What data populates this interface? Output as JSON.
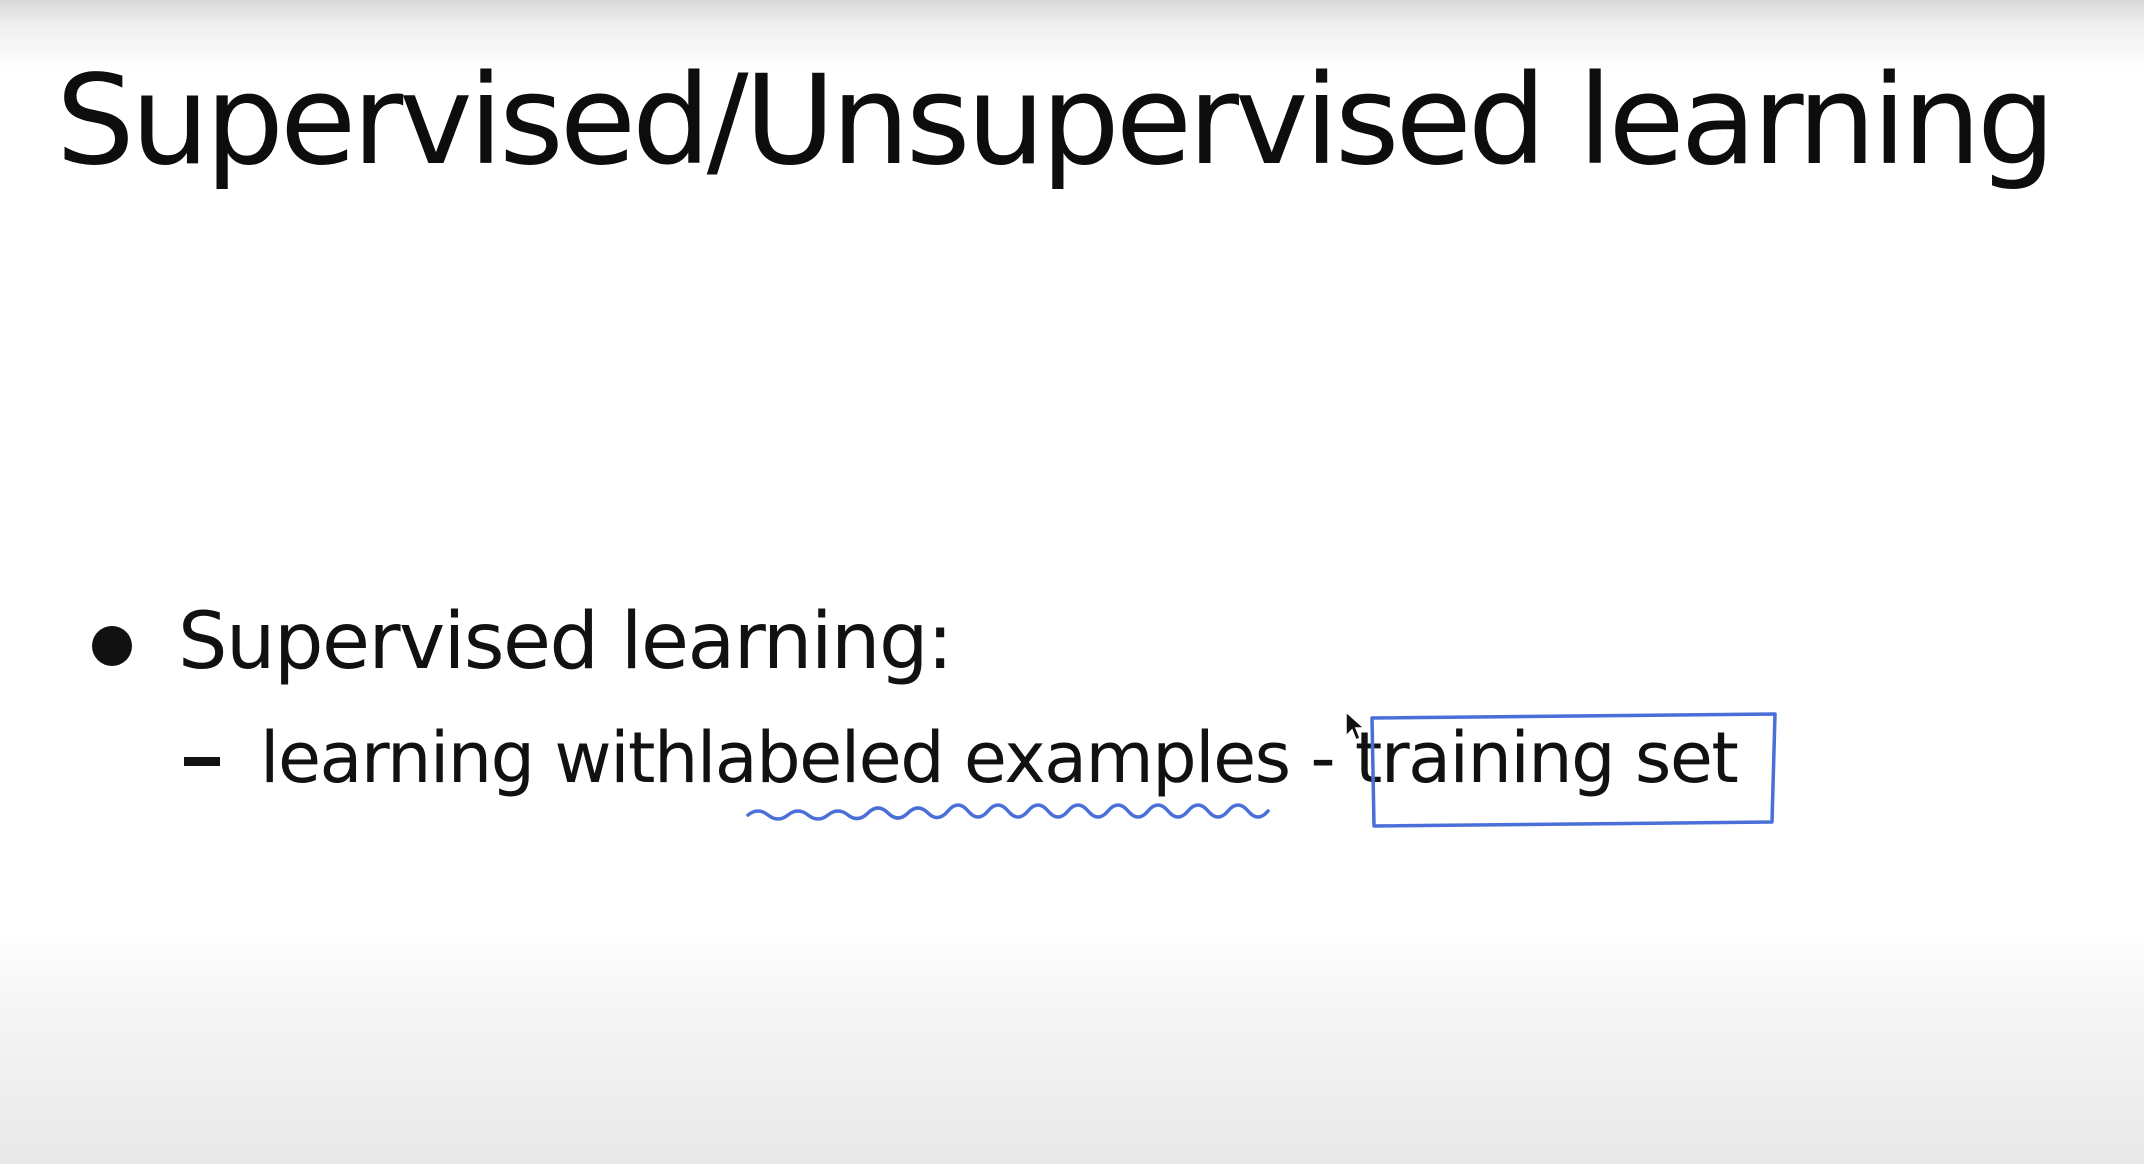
{
  "slide": {
    "title": "Supervised/Unsupervised learning",
    "bullet": {
      "text": "Supervised learning:"
    },
    "sub_bullet": {
      "text_before": "learning with ",
      "highlighted_underline": "labeled examples",
      "separator": " - ",
      "boxed_text": "training set"
    }
  },
  "annotations": {
    "ink_color": "#4a6fd8",
    "underline_style": "wavy",
    "box_style": "hand-drawn rectangle"
  },
  "icons": {
    "cursor": "arrow-cursor-icon"
  }
}
